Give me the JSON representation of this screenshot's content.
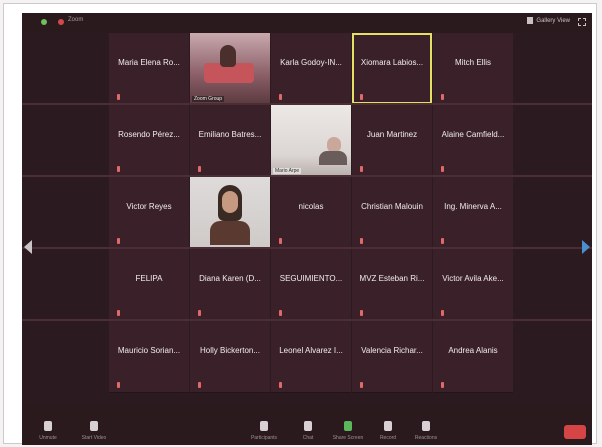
{
  "topbar": {
    "meeting_info": "Zoom",
    "view_label": "Gallery View"
  },
  "participants": [
    {
      "name": "Maria Elena Ro...",
      "video": false
    },
    {
      "name": "",
      "video": true,
      "video_label": "Zoom Group"
    },
    {
      "name": "Karla Godoy-IN...",
      "video": false
    },
    {
      "name": "Xiomara Labios...",
      "video": false,
      "active": true
    },
    {
      "name": "Mitch Ellis",
      "video": false
    },
    {
      "name": "Rosendo Pérez...",
      "video": false
    },
    {
      "name": "Emiliano Batres...",
      "video": false
    },
    {
      "name": "",
      "video": true,
      "video_label": "Mario Arpe"
    },
    {
      "name": "Juan Martinez",
      "video": false
    },
    {
      "name": "Alaine Camfield...",
      "video": false
    },
    {
      "name": "Victor Reyes",
      "video": false
    },
    {
      "name": "",
      "video": true
    },
    {
      "name": "nicolas",
      "video": false
    },
    {
      "name": "Christian Malouin",
      "video": false
    },
    {
      "name": "Ing. Minerva A...",
      "video": false
    },
    {
      "name": "FELIPA",
      "video": false
    },
    {
      "name": "Diana Karen (D...",
      "video": false
    },
    {
      "name": "SEGUIMIENTO...",
      "video": false
    },
    {
      "name": "MVZ Esteban Ri...",
      "video": false
    },
    {
      "name": "Victor Avila Ake...",
      "video": false
    },
    {
      "name": "Mauricio Sorian...",
      "video": false
    },
    {
      "name": "Holly Bickerton...",
      "video": false
    },
    {
      "name": "Leonel Alvarez I...",
      "video": false
    },
    {
      "name": "Valencia Richar...",
      "video": false
    },
    {
      "name": "Andrea Alanis",
      "video": false
    }
  ],
  "toolbar": {
    "mute_label": "Unmute",
    "video_label": "Start Video",
    "participants_label": "Participants",
    "participants_count": "83",
    "chat_label": "Chat",
    "share_label": "Share Screen",
    "record_label": "Record",
    "reactions_label": "Reactions"
  },
  "colors": {
    "accent_active": "#e5e065",
    "end_button": "#d64545",
    "share_green": "#5ab85a"
  }
}
